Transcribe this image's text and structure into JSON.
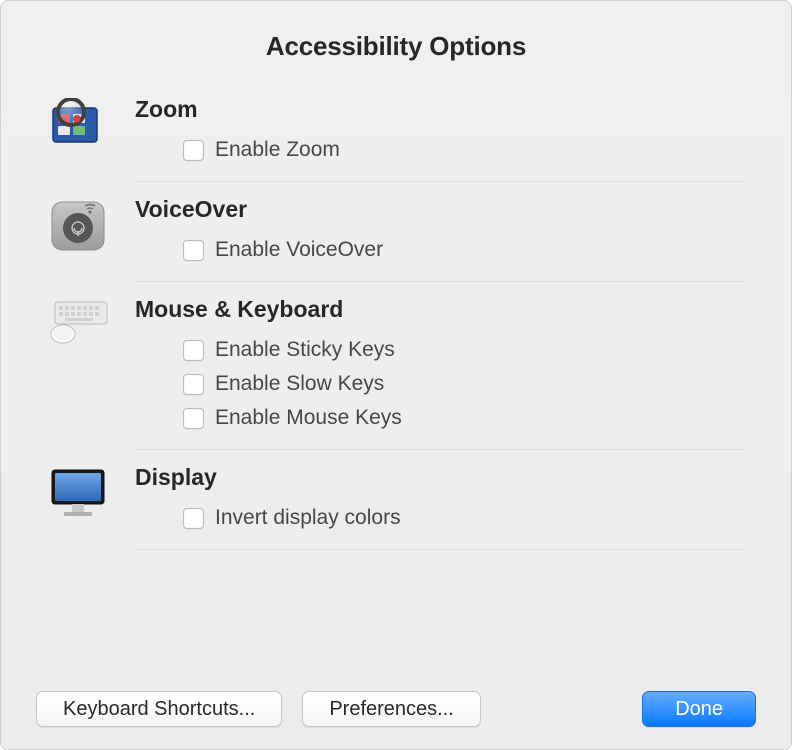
{
  "title": "Accessibility Options",
  "sections": {
    "zoom": {
      "title": "Zoom",
      "options": [
        {
          "label": "Enable Zoom",
          "checked": false
        }
      ]
    },
    "voiceover": {
      "title": "VoiceOver",
      "options": [
        {
          "label": "Enable VoiceOver",
          "checked": false
        }
      ]
    },
    "mousekeyboard": {
      "title": "Mouse & Keyboard",
      "options": [
        {
          "label": "Enable Sticky Keys",
          "checked": false
        },
        {
          "label": "Enable Slow Keys",
          "checked": false
        },
        {
          "label": "Enable Mouse Keys",
          "checked": false
        }
      ]
    },
    "display": {
      "title": "Display",
      "options": [
        {
          "label": "Invert display colors",
          "checked": false
        }
      ]
    }
  },
  "buttons": {
    "keyboard_shortcuts": "Keyboard Shortcuts...",
    "preferences": "Preferences...",
    "done": "Done"
  }
}
